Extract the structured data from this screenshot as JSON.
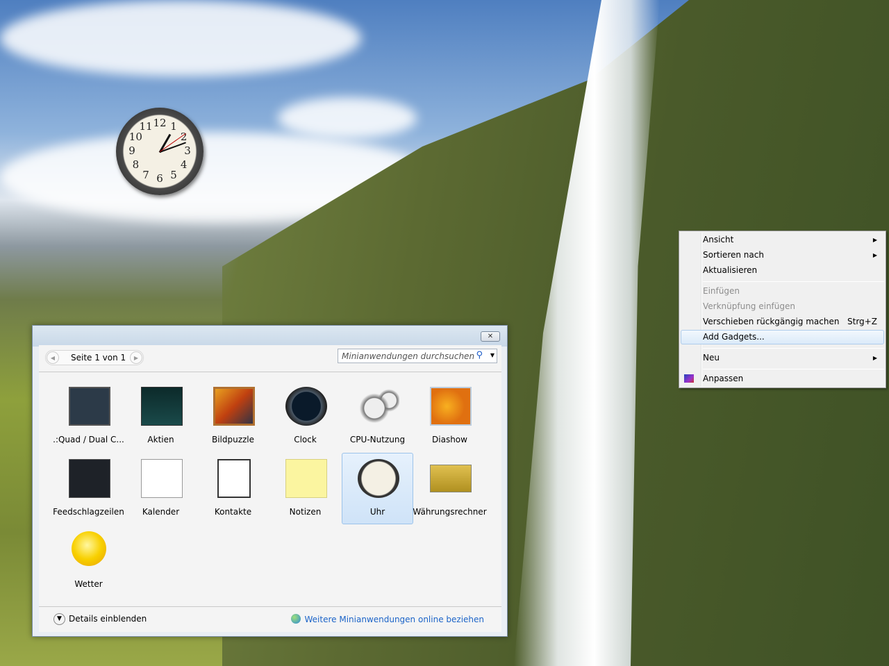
{
  "desktop": {
    "clock": {
      "numerals": [
        "12",
        "1",
        "2",
        "3",
        "4",
        "5",
        "6",
        "7",
        "8",
        "9",
        "10",
        "11"
      ]
    }
  },
  "gallery": {
    "close_label": "✕",
    "page_label": "Seite 1 von 1",
    "search_placeholder": "Minianwendungen durchsuchen",
    "gadgets": [
      {
        "label": ".:Quad / Dual C...",
        "icon": "cpu-monitor-icon"
      },
      {
        "label": "Aktien",
        "icon": "stocks-chart-icon"
      },
      {
        "label": "Bildpuzzle",
        "icon": "picture-puzzle-icon"
      },
      {
        "label": "Clock",
        "icon": "dark-clock-icon"
      },
      {
        "label": "CPU-Nutzung",
        "icon": "cpu-gauge-icon"
      },
      {
        "label": "Diashow",
        "icon": "slideshow-icon"
      },
      {
        "label": "Feedschlagzeilen",
        "icon": "feed-headlines-icon"
      },
      {
        "label": "Kalender",
        "icon": "calendar-icon"
      },
      {
        "label": "Kontakte",
        "icon": "contacts-icon"
      },
      {
        "label": "Notizen",
        "icon": "notes-icon"
      },
      {
        "label": "Uhr",
        "icon": "clock-icon",
        "selected": true
      },
      {
        "label": "Währungsrechner",
        "icon": "currency-icon"
      },
      {
        "label": "Wetter",
        "icon": "weather-sun-icon"
      }
    ],
    "details_label": "Details einblenden",
    "online_label": "Weitere Minianwendungen online beziehen"
  },
  "context_menu": {
    "items": [
      {
        "label": "Ansicht",
        "submenu": true
      },
      {
        "label": "Sortieren nach",
        "submenu": true
      },
      {
        "label": "Aktualisieren"
      },
      {
        "label": "Einfügen",
        "disabled": true
      },
      {
        "label": "Verknüpfung einfügen",
        "disabled": true
      },
      {
        "label": "Verschieben rückgängig machen",
        "shortcut": "Strg+Z"
      },
      {
        "label": "Add Gadgets...",
        "highlighted": true
      },
      {
        "label": "Neu",
        "submenu": true
      },
      {
        "label": "Anpassen",
        "icon": "personalize-icon"
      }
    ]
  }
}
